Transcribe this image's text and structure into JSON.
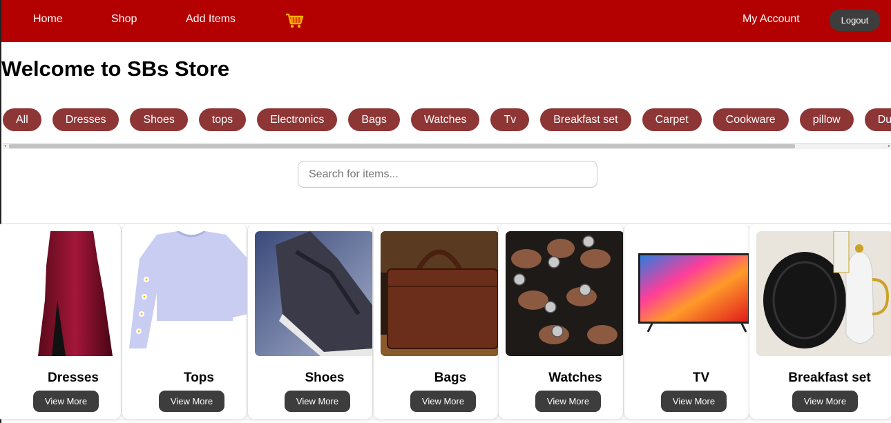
{
  "nav": {
    "home": "Home",
    "shop": "Shop",
    "add_items": "Add Items",
    "cart_icon": "shopping-cart-icon",
    "account": "My Account",
    "logout": "Logout"
  },
  "page": {
    "title": "Welcome to SBs Store"
  },
  "categories": [
    "All",
    "Dresses",
    "Shoes",
    "tops",
    "Electronics",
    "Bags",
    "Watches",
    "Tv",
    "Breakfast set",
    "Carpet",
    "Cookware",
    "pillow",
    "Du"
  ],
  "search": {
    "placeholder": "Search for items..."
  },
  "cards": [
    {
      "name": "Dresses",
      "button": "View More"
    },
    {
      "name": "Tops",
      "button": "View More"
    },
    {
      "name": "Shoes",
      "button": "View More"
    },
    {
      "name": "Bags",
      "button": "View More"
    },
    {
      "name": "Watches",
      "button": "View More"
    },
    {
      "name": "TV",
      "button": "View More"
    },
    {
      "name": "Breakfast set",
      "button": "View More"
    }
  ],
  "colors": {
    "navbar": "#b30000",
    "pill": "#8e3535",
    "button": "#3d3d3d"
  }
}
